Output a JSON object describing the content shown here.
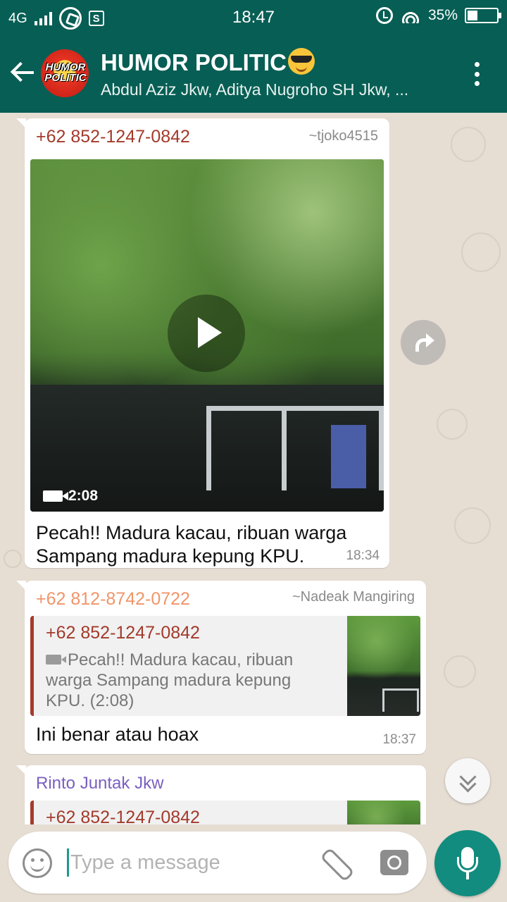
{
  "status_bar": {
    "network": "4G",
    "time": "18:47",
    "battery": "35%",
    "battery_level": 0.35,
    "icons": [
      "signal-icon",
      "whatsapp-icon",
      "s-notification-icon",
      "alarm-icon",
      "wifi-icon",
      "battery-icon"
    ]
  },
  "header": {
    "avatar_text": "HUMOR POLITIC",
    "title": "HUMOR POLITIC",
    "title_emoji": "smiling-face-with-sunglasses",
    "members": "Abdul Aziz Jkw, Aditya Nugroho SH Jkw, ...",
    "colors": {
      "bar": "#075e54"
    }
  },
  "messages": [
    {
      "sender": "+62 852-1247-0842",
      "sender_color": "#a33a2b",
      "push_name": "~tjoko4515",
      "video_duration": "2:08",
      "caption_line1": "Pecah!! Madura kacau, ribuan warga",
      "caption_line2": "Sampang madura kepung KPU.",
      "time": "18:34"
    },
    {
      "sender": "+62 812-8742-0722",
      "sender_color": "#f0956a",
      "push_name": "~Nadeak Mangiring",
      "quote_sender": "+62 852-1247-0842",
      "quote_line1": "Pecah!! Madura kacau, ribuan",
      "quote_line2": "warga Sampang madura kepung",
      "quote_line3": "KPU. (2:08)",
      "text": "Ini benar atau hoax",
      "time": "18:37"
    },
    {
      "sender": "Rinto Juntak Jkw",
      "sender_color": "#7a5fc0",
      "quote_sender": "+62 852-1247-0842"
    }
  ],
  "input": {
    "placeholder": "Type a message"
  },
  "accent": "#128c7e"
}
